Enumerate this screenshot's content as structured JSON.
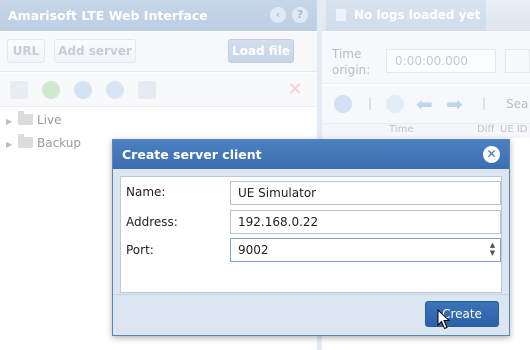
{
  "app": {
    "title": "Amarisoft LTE Web Interface",
    "left_toolbar": {
      "url_label": "URL",
      "add_server_label": "Add server",
      "load_file_label": "Load file"
    },
    "tree": [
      {
        "label": "Live"
      },
      {
        "label": "Backup"
      }
    ],
    "right": {
      "tab_label": "No logs loaded yet",
      "time_origin_label": "Time origin:",
      "time_origin_value": "0:00:00.000",
      "search_label": "Sea",
      "columns": [
        "Time",
        "Diff",
        "UE ID"
      ]
    }
  },
  "dialog": {
    "title": "Create server client",
    "fields": [
      {
        "label": "Name:",
        "value": "UE Simulator"
      },
      {
        "label": "Address:",
        "value": "192.168.0.22"
      },
      {
        "label": "Port:",
        "value": "9002"
      }
    ],
    "create_label": "Create"
  },
  "colors": {
    "accent": "#3b6fb1",
    "header_bg": "#a8c1de",
    "close_red": "#f2b3b3"
  }
}
